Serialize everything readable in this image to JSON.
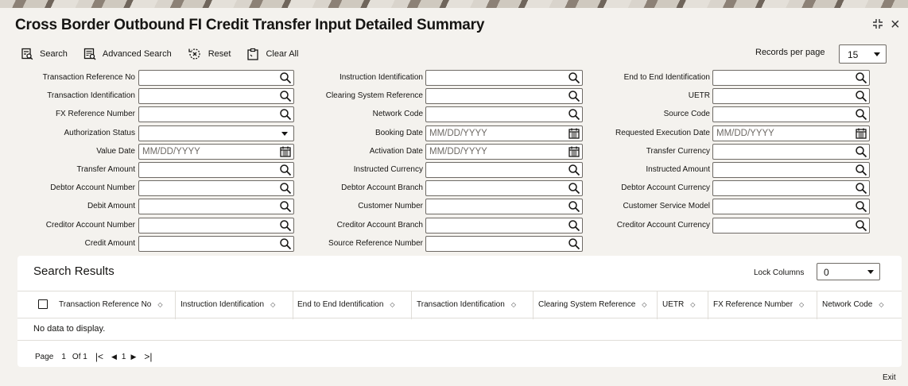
{
  "title": "Cross Border Outbound FI Credit Transfer Input Detailed Summary",
  "window": {
    "expand_icon": "expand-icon",
    "close_label": "×"
  },
  "toolbar": {
    "search_label": "Search",
    "advanced_search_label": "Advanced Search",
    "reset_label": "Reset",
    "clear_all_label": "Clear All"
  },
  "records_per_page": {
    "label": "Records per page",
    "value": "15"
  },
  "form": {
    "col1": [
      {
        "label": "Transaction Reference No",
        "type": "search"
      },
      {
        "label": "Transaction Identification",
        "type": "search"
      },
      {
        "label": "FX Reference Number",
        "type": "search"
      },
      {
        "label": "Authorization Status",
        "type": "select"
      },
      {
        "label": "Value Date",
        "type": "date",
        "placeholder": "MM/DD/YYYY"
      },
      {
        "label": "Transfer Amount",
        "type": "search"
      },
      {
        "label": "Debtor Account Number",
        "type": "search"
      },
      {
        "label": "Debit Amount",
        "type": "search"
      },
      {
        "label": "Creditor Account Number",
        "type": "search"
      },
      {
        "label": "Credit Amount",
        "type": "search"
      }
    ],
    "col2": [
      {
        "label": "Instruction Identification",
        "type": "search"
      },
      {
        "label": "Clearing System Reference",
        "type": "search"
      },
      {
        "label": "Network Code",
        "type": "search"
      },
      {
        "label": "Booking Date",
        "type": "date",
        "placeholder": "MM/DD/YYYY"
      },
      {
        "label": "Activation Date",
        "type": "date",
        "placeholder": "MM/DD/YYYY"
      },
      {
        "label": "Instructed Currency",
        "type": "search"
      },
      {
        "label": "Debtor Account Branch",
        "type": "search"
      },
      {
        "label": "Customer Number",
        "type": "search"
      },
      {
        "label": "Creditor Account Branch",
        "type": "search"
      },
      {
        "label": "Source Reference Number",
        "type": "search"
      }
    ],
    "col3": [
      {
        "label": "End to End Identification",
        "type": "search"
      },
      {
        "label": "UETR",
        "type": "search"
      },
      {
        "label": "Source Code",
        "type": "search"
      },
      {
        "label": "Requested Execution Date",
        "type": "date",
        "placeholder": "MM/DD/YYYY"
      },
      {
        "label": "Transfer Currency",
        "type": "search"
      },
      {
        "label": "Instructed Amount",
        "type": "search"
      },
      {
        "label": "Debtor Account Currency",
        "type": "search"
      },
      {
        "label": "Customer Service Model",
        "type": "search"
      },
      {
        "label": "Creditor Account Currency",
        "type": "search"
      }
    ]
  },
  "results": {
    "title": "Search Results",
    "lock_columns_label": "Lock Columns",
    "lock_columns_value": "0",
    "columns": [
      "Transaction Reference No",
      "Instruction Identification",
      "End to End Identification",
      "Transaction Identification",
      "Clearing System Reference",
      "UETR",
      "FX Reference Number",
      "Network Code"
    ],
    "empty_text": "No data to display.",
    "pager": {
      "page_label": "Page",
      "page_value": "1",
      "of_label": "Of 1",
      "current": "1"
    }
  },
  "footer": {
    "exit_label": "Exit"
  }
}
